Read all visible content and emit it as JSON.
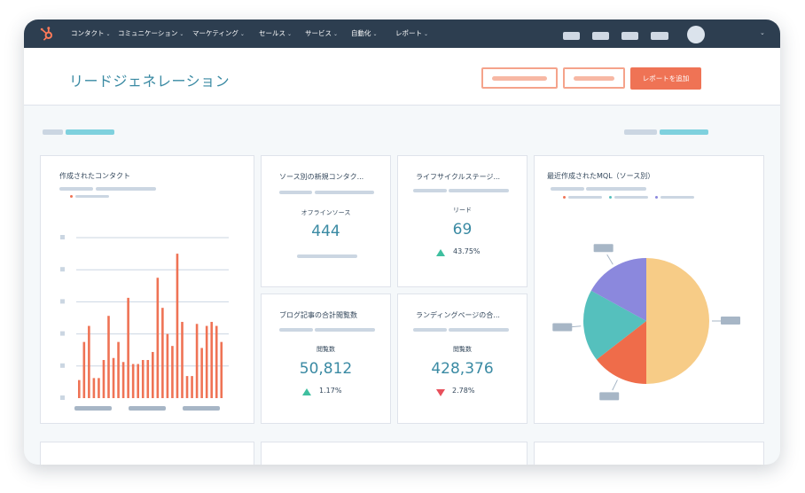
{
  "nav": {
    "items": [
      {
        "label": "コンタクト"
      },
      {
        "label": "コミュニケーション"
      },
      {
        "label": "マーケティング"
      },
      {
        "label": "セールス"
      },
      {
        "label": "サービス"
      },
      {
        "label": "自動化"
      },
      {
        "label": "レポート"
      }
    ],
    "chevron": "⌄"
  },
  "header": {
    "title": "リードジェネレーション",
    "add_report_button": "レポートを追加"
  },
  "cards": {
    "contacts_created": {
      "title": "作成されたコンタクト"
    },
    "new_contacts_by_source": {
      "title": "ソース別の新規コンタク...",
      "label": "オフラインソース",
      "value": "444"
    },
    "lifecycle_stage": {
      "title": "ライフサイクルステージ...",
      "label": "リード",
      "value": "69",
      "change": "43.75%",
      "direction": "up"
    },
    "blog_views": {
      "title": "ブログ記事の合計閲覧数",
      "label": "閲覧数",
      "value": "50,812",
      "change": "1.17%",
      "direction": "up"
    },
    "landing_views": {
      "title": "ランディングページの合...",
      "label": "閲覧数",
      "value": "428,376",
      "change": "2.78%",
      "direction": "down"
    },
    "mql_by_source": {
      "title": "最近作成されたMQL（ソース別）"
    }
  },
  "colors": {
    "nav_bg": "#2d3e50",
    "accent": "#ef7355",
    "teal": "#3a8aa3",
    "up": "#3fbf9f",
    "down": "#e8505b"
  },
  "chart_data": [
    {
      "type": "bar",
      "title": "作成されたコンタクト",
      "values": [
        9,
        28,
        36,
        10,
        10,
        19,
        41,
        20,
        28,
        18,
        50,
        17,
        17,
        19,
        19,
        23,
        60,
        45,
        32,
        26,
        72,
        38,
        11,
        11,
        37,
        25,
        36,
        38,
        36,
        28
      ],
      "ylim": [
        0,
        80
      ],
      "colors": [
        "#ef7355"
      ],
      "grid": true
    },
    {
      "type": "pie",
      "title": "最近作成されたMQL（ソース別）",
      "values": [
        50,
        14.5,
        18.5,
        17
      ],
      "colors": [
        "#f7cc87",
        "#ef6c4a",
        "#55c0bd",
        "#8b88dd"
      ]
    }
  ]
}
